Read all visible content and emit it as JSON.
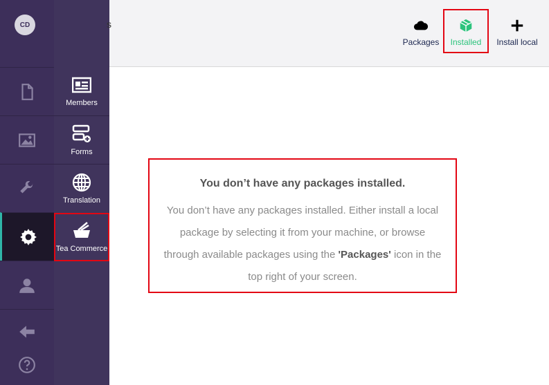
{
  "user": {
    "initials": "CD"
  },
  "sections": [
    {
      "name": "content",
      "icon": "document-icon"
    },
    {
      "name": "media",
      "icon": "image-icon"
    },
    {
      "name": "settings",
      "icon": "wrench-icon"
    },
    {
      "name": "developer",
      "icon": "gear-icon"
    },
    {
      "name": "users",
      "icon": "user-icon"
    }
  ],
  "tray": {
    "items": [
      {
        "label": "Members",
        "icon": "member-card-icon"
      },
      {
        "label": "Forms",
        "icon": "forms-icon"
      },
      {
        "label": "Translation",
        "icon": "globe-icon"
      },
      {
        "label": "Tea Commerce",
        "icon": "basket-icon"
      }
    ]
  },
  "header": {
    "partial_title": "s",
    "actions": [
      {
        "label": "Packages",
        "icon": "cloud-icon"
      },
      {
        "label": "Installed",
        "icon": "box-icon"
      },
      {
        "label": "Install local",
        "icon": "plus-icon"
      }
    ]
  },
  "empty_state": {
    "title": "You don’t have any packages installed.",
    "text_part1": "You don’t have any packages installed. Either install a local package by selecting it from your machine, or browse through available packages using the ",
    "text_bold": "'Packages'",
    "text_part2": " icon in the top right of your screen."
  },
  "colors": {
    "accent": "#2bc37c",
    "highlight": "#e30613",
    "section_bg": "#3d2f5a"
  }
}
